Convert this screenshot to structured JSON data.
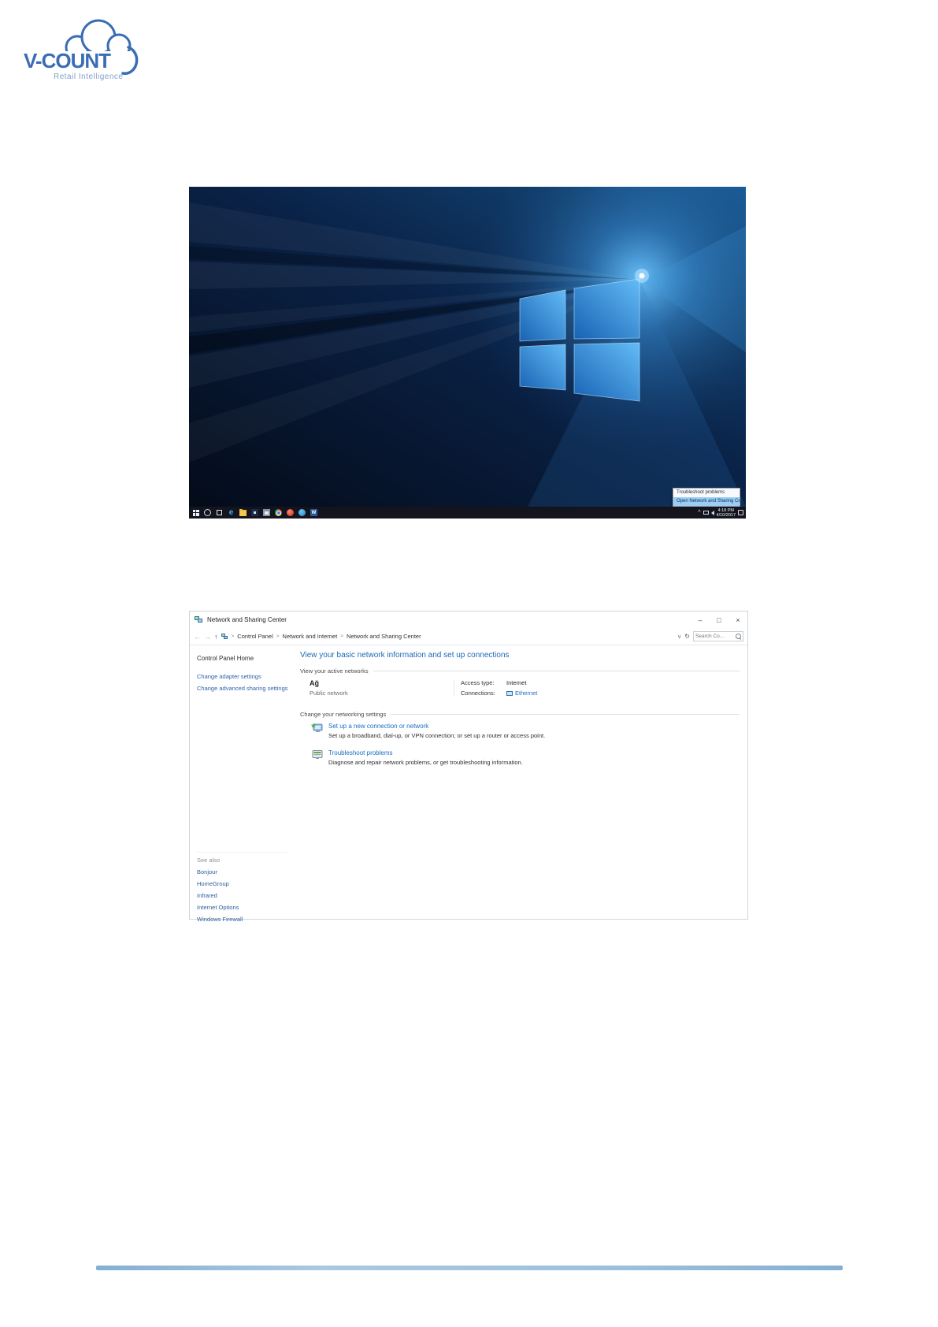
{
  "logo": {
    "brand": "V-COUNT",
    "tagline": "Retail Intelligence",
    "color": "#3a6db4"
  },
  "desktop": {
    "taskbar": {
      "icon_names": [
        "start",
        "search",
        "task-view",
        "edge",
        "file-explorer",
        "store",
        "app-window",
        "chrome",
        "browser",
        "skype",
        "word"
      ],
      "edge_glyph": "e",
      "word_glyph": "W",
      "tray": {
        "chevron": "^",
        "time": "4:18 PM",
        "date": "4/10/2017"
      }
    },
    "context_menu": {
      "items": [
        {
          "label": "Troubleshoot problems",
          "highlighted": false
        },
        {
          "label": "Open Network and Sharing Center",
          "highlighted": true
        }
      ]
    }
  },
  "window": {
    "title": "Network and Sharing Center",
    "controls": {
      "minimize": "–",
      "maximize": "□",
      "close": "×"
    },
    "toolbar": {
      "back": "←",
      "forward": "→",
      "up": "↑",
      "sep": ">",
      "breadcrumb": [
        "Control Panel",
        "Network and Internet",
        "Network and Sharing Center"
      ],
      "dropdown": "∨",
      "refresh": "↻",
      "search_placeholder": "Search Co..."
    },
    "sidebar": {
      "home": "Control Panel Home",
      "links": [
        "Change adapter settings",
        "Change advanced sharing settings"
      ],
      "see_also": {
        "header": "See also",
        "links": [
          "Bonjour",
          "HomeGroup",
          "Infrared",
          "Internet Options",
          "Windows Firewall"
        ]
      }
    },
    "main": {
      "heading": "View your basic network information and set up connections",
      "active_section_label": "View your active networks",
      "network": {
        "name": "Ağ",
        "type": "Public network",
        "access_type_label": "Access type:",
        "access_type_value": "Internet",
        "connections_label": "Connections:",
        "connections_value": "Ethernet"
      },
      "settings_section_label": "Change your networking settings",
      "settings": [
        {
          "link": "Set up a new connection or network",
          "desc": "Set up a broadband, dial-up, or VPN connection; or set up a router or access point."
        },
        {
          "link": "Troubleshoot problems",
          "desc": "Diagnose and repair network problems, or get troubleshooting information."
        }
      ]
    }
  },
  "colors": {
    "accent_heading": "#1d6ab5",
    "link_blue": "#1b6ec2",
    "taskbar_bg": "#14141f",
    "menu_highlight": "#9ccef5",
    "footer_bar": "#8fb8d8",
    "wallpaper_deep": "#07182f",
    "wallpaper_glow": "#55b9ff"
  }
}
